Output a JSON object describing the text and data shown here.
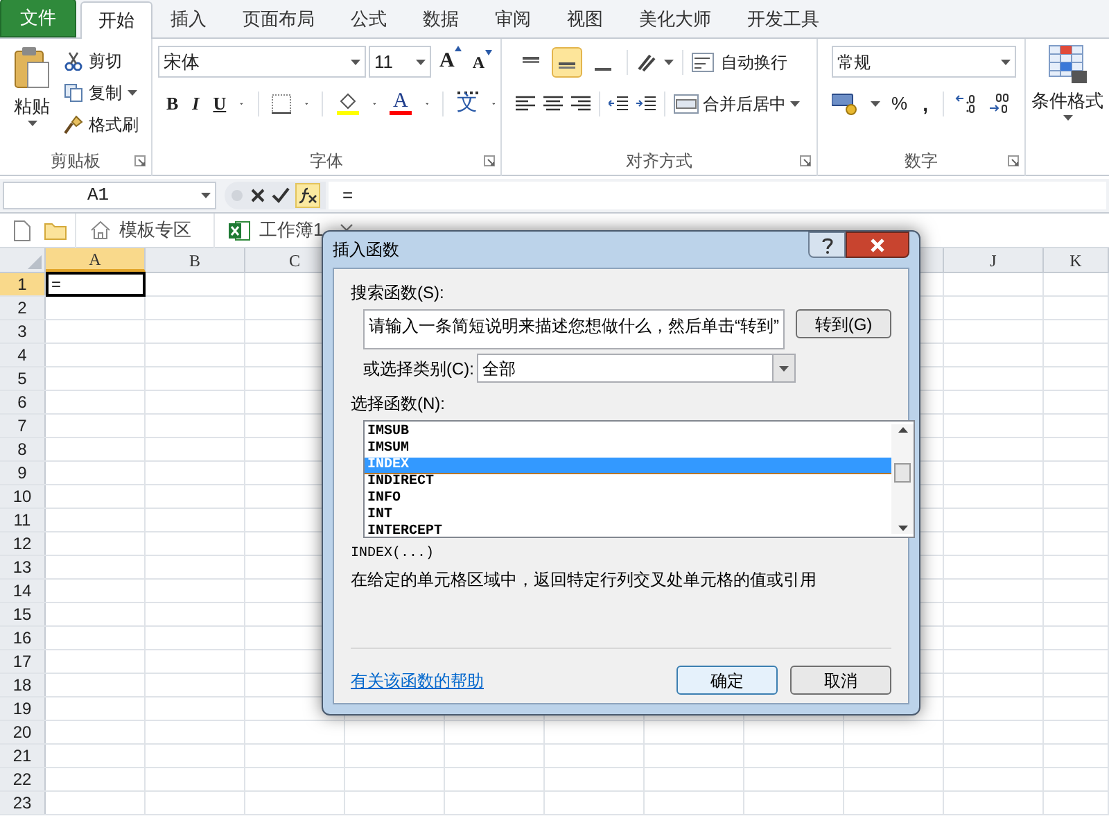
{
  "tabs": [
    {
      "label": "文件",
      "kind": "file",
      "selected": false
    },
    {
      "label": "开始",
      "kind": "tab",
      "selected": true
    },
    {
      "label": "插入",
      "kind": "tab",
      "selected": false
    },
    {
      "label": "页面布局",
      "kind": "tab",
      "selected": false
    },
    {
      "label": "公式",
      "kind": "tab",
      "selected": false
    },
    {
      "label": "数据",
      "kind": "tab",
      "selected": false
    },
    {
      "label": "审阅",
      "kind": "tab",
      "selected": false
    },
    {
      "label": "视图",
      "kind": "tab",
      "selected": false
    },
    {
      "label": "美化大师",
      "kind": "tab",
      "selected": false
    },
    {
      "label": "开发工具",
      "kind": "tab",
      "selected": false
    }
  ],
  "ribbon": {
    "clipboard": {
      "paste": "粘贴",
      "cut": "剪切",
      "copy": "复制",
      "format_painter": "格式刷",
      "group_label": "剪贴板"
    },
    "font": {
      "font_name": "宋体",
      "font_size": "11",
      "grow_font": "A",
      "shrink_font": "A",
      "bold": "B",
      "italic": "I",
      "underline": "U",
      "font_color": "A",
      "phonetic": "文",
      "group_label": "字体"
    },
    "alignment": {
      "vertical_align": [
        {
          "selected": false
        },
        {
          "selected": true
        },
        {
          "selected": false
        }
      ],
      "wrap_text": "自动换行",
      "merge_center": "合并后居中",
      "group_label": "对齐方式"
    },
    "number": {
      "format": "常规",
      "percent": "%",
      "comma": ",",
      "group_label": "数字"
    },
    "styles": {
      "conditional_format": "条件格式"
    }
  },
  "formula_bar": {
    "name_box": "A1",
    "formula": "="
  },
  "doc_tabs": [
    {
      "label": "模板专区",
      "kind": "template"
    },
    {
      "label": "工作簿1",
      "kind": "workbook"
    }
  ],
  "sheet": {
    "columns": [
      {
        "label": "A",
        "selected": true
      },
      {
        "label": "B",
        "selected": false
      },
      {
        "label": "C",
        "selected": false
      },
      {
        "label": "J",
        "selected": false
      },
      {
        "label": "K",
        "selected": false
      }
    ],
    "rows": [
      {
        "label": "1",
        "selected": true
      },
      {
        "label": "2",
        "selected": false
      },
      {
        "label": "3",
        "selected": false
      },
      {
        "label": "4",
        "selected": false
      },
      {
        "label": "5",
        "selected": false
      },
      {
        "label": "6",
        "selected": false
      },
      {
        "label": "7",
        "selected": false
      },
      {
        "label": "8",
        "selected": false
      },
      {
        "label": "9",
        "selected": false
      },
      {
        "label": "10",
        "selected": false
      },
      {
        "label": "11",
        "selected": false
      },
      {
        "label": "12",
        "selected": false
      },
      {
        "label": "13",
        "selected": false
      },
      {
        "label": "14",
        "selected": false
      },
      {
        "label": "15",
        "selected": false
      },
      {
        "label": "16",
        "selected": false
      },
      {
        "label": "17",
        "selected": false
      },
      {
        "label": "18",
        "selected": false
      },
      {
        "label": "19",
        "selected": false
      },
      {
        "label": "20",
        "selected": false
      },
      {
        "label": "21",
        "selected": false
      },
      {
        "label": "22",
        "selected": false
      },
      {
        "label": "23",
        "selected": false
      }
    ],
    "active_cell_value": "="
  },
  "dialog": {
    "title": "插入函数",
    "search_label": "搜索函数(S):",
    "search_value": "请输入一条简短说明来描述您想做什么，然后单击“转到”",
    "go_button": "转到(G)",
    "category_label": "或选择类别(C):",
    "category_value": "全部",
    "function_label": "选择函数(N):",
    "functions": [
      {
        "name": "IMSUB",
        "selected": false
      },
      {
        "name": "IMSUM",
        "selected": false
      },
      {
        "name": "INDEX",
        "selected": true
      },
      {
        "name": "INDIRECT",
        "selected": false
      },
      {
        "name": "INFO",
        "selected": false
      },
      {
        "name": "INT",
        "selected": false
      },
      {
        "name": "INTERCEPT",
        "selected": false
      }
    ],
    "signature": "INDEX(...)",
    "description": "在给定的单元格区域中，返回特定行列交叉处单元格的值或引用",
    "help_link": "有关该函数的帮助",
    "ok_button": "确定",
    "cancel_button": "取消"
  }
}
